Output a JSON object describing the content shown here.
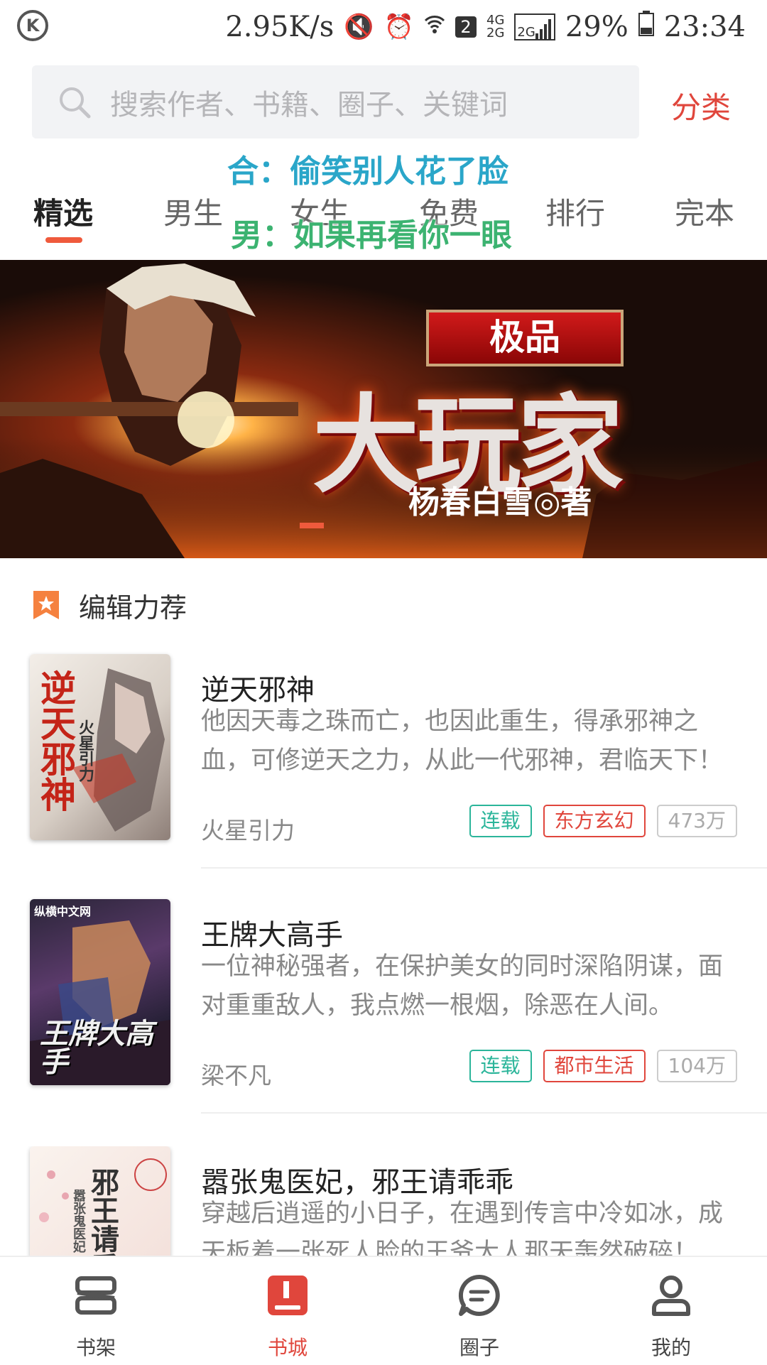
{
  "status_bar": {
    "speed": "2.95K/s",
    "sim_slot": "2",
    "net_top": "4G",
    "net_bottom": "2G",
    "net2": "2G",
    "battery": "29%",
    "time": "23:34"
  },
  "search": {
    "placeholder": "搜索作者、书籍、圈子、关键词",
    "category_label": "分类"
  },
  "tabs": [
    {
      "label": "精选",
      "active": true
    },
    {
      "label": "男生"
    },
    {
      "label": "女生"
    },
    {
      "label": "免费"
    },
    {
      "label": "排行"
    },
    {
      "label": "完本"
    }
  ],
  "lyrics": {
    "line1": "合：偷笑别人花了脸",
    "line2": "男：如果再看你一眼"
  },
  "banner": {
    "badge": "极品",
    "title": "大玩家",
    "author": "杨春白雪◎著"
  },
  "section": {
    "title": "编辑力荐"
  },
  "books": [
    {
      "title": "逆天邪神",
      "desc": "他因天毒之珠而亡，也因此重生，得承邪神之血，可修逆天之力，从此一代邪神，君临天下！",
      "author": "火星引力",
      "status": "连载",
      "genre": "东方玄幻",
      "count": "473万",
      "cover_text": "逆天邪神",
      "cover_sub": "火星引力"
    },
    {
      "title": "王牌大高手",
      "desc": "一位神秘强者，在保护美女的同时深陷阴谋，面对重重敌人，我点燃一根烟，除恶在人间。",
      "author": "梁不凡",
      "status": "连载",
      "genre": "都市生活",
      "count": "104万",
      "cover_text": "王牌大高手",
      "cover_brand": "纵横中文网"
    },
    {
      "title": "嚣张鬼医妃，邪王请乖乖",
      "desc": "穿越后逍遥的小日子，在遇到传言中冷如冰，成天板着一张死人脸的王爷大人那天轰然破碎！",
      "cover_text": "邪王请乖乖",
      "cover_sub": "嚣张鬼医妃"
    }
  ],
  "bottom_nav": [
    {
      "label": "书架"
    },
    {
      "label": "书城",
      "active": true
    },
    {
      "label": "圈子"
    },
    {
      "label": "我的"
    }
  ],
  "colors": {
    "accent": "#e0463c",
    "tab_indicator": "#ef5a3c",
    "tag_serial": "#2bb59a",
    "tag_genre": "#e0463c"
  }
}
